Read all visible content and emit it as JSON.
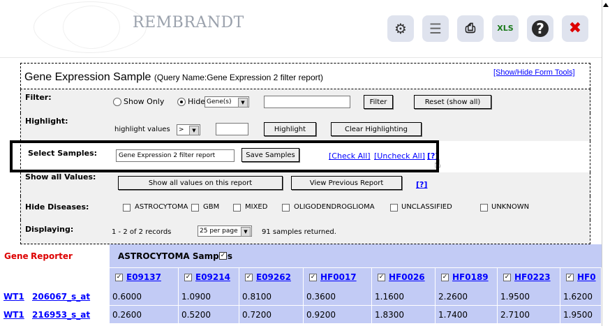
{
  "header": {
    "app_title": "REMBRANDT",
    "toolbar_icons": [
      "network-icon",
      "report-icon",
      "printer-icon",
      "excel-icon",
      "help-icon",
      "trash-icon"
    ]
  },
  "form": {
    "title": "Gene Expression Sample",
    "subtitle": "(Query Name:Gene Expression 2 filter report)",
    "show_hide_link": "[Show/Hide Form Tools]",
    "filter": {
      "label": "Filter:",
      "show_only": "Show Only",
      "hide": "Hide",
      "type_value": "Gene(s)",
      "text_value": "",
      "filter_button": "Filter",
      "reset_button": "Reset (show all)"
    },
    "highlight": {
      "label": "Highlight:",
      "prefix": "highlight values",
      "operator_value": ">",
      "text_value": "",
      "highlight_button": "Highlight",
      "clear_button": "Clear Highlighting"
    },
    "select_samples": {
      "label": "Select Samples:",
      "name_value": "Gene Expression 2 filter report",
      "save_button": "Save Samples",
      "check_all": "[Check All]",
      "uncheck_all": "[Uncheck All]",
      "help": "[?]"
    },
    "show_all_values": {
      "label": "Show all Values:",
      "show_button": "Show all values on this report",
      "previous_button": "View Previous Report",
      "help": "[?]"
    },
    "hide_diseases": {
      "label": "Hide Diseases:",
      "options": [
        "ASTROCYTOMA",
        "GBM",
        "MIXED",
        "OLIGODENDROGLIOMA",
        "UNCLASSIFIED",
        "UNKNOWN"
      ]
    },
    "displaying": {
      "label": "Displaying:",
      "records": "1 - 2 of 2 records",
      "per_page_value": "25 per page",
      "samples_returned": "91 samples returned."
    }
  },
  "table": {
    "gene_header": "Gene",
    "reporter_header": "Reporter",
    "group_header": "ASTROCYTOMA Samples",
    "samples": [
      "E09137",
      "E09214",
      "E09262",
      "HF0017",
      "HF0026",
      "HF0189",
      "HF0223",
      "HF0"
    ],
    "rows": [
      {
        "gene": "WT1",
        "reporter": "206067_s_at",
        "values": [
          "0.6000",
          "1.0900",
          "0.8100",
          "0.3600",
          "1.1600",
          "2.2600",
          "1.9500",
          "1.6200"
        ]
      },
      {
        "gene": "WT1",
        "reporter": "216953_s_at",
        "values": [
          "0.2600",
          "0.5200",
          "0.7200",
          "0.9200",
          "1.8300",
          "1.7400",
          "2.7100",
          "1.9500"
        ]
      }
    ]
  }
}
